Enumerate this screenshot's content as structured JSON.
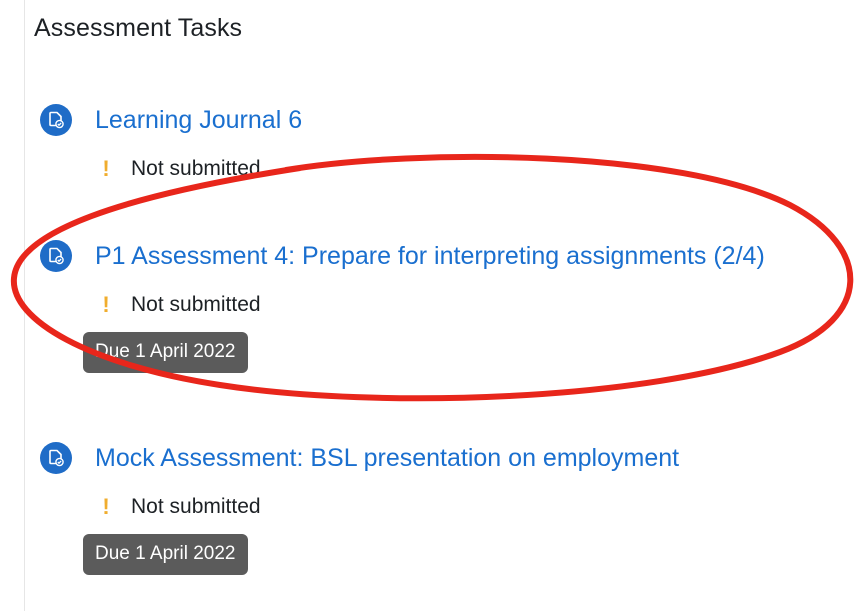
{
  "section": {
    "title": "Assessment Tasks"
  },
  "tasks": [
    {
      "title": "Learning Journal 6",
      "status": "Not submitted",
      "due": ""
    },
    {
      "title": "P1 Assessment 4: Prepare for interpreting assignments (2/4)",
      "status": "Not submitted",
      "due": "Due 1 April 2022"
    },
    {
      "title": "Mock Assessment: BSL presentation on employment",
      "status": "Not submitted",
      "due": "Due 1 April 2022"
    }
  ],
  "icons": {
    "task": "assignment-icon",
    "status": "exclamation-icon"
  },
  "colors": {
    "link": "#1a6fcf",
    "icon_bg": "#1f6cc7",
    "warning": "#f0ad2e",
    "badge_bg": "#5b5b5b",
    "annotation": "#e8261b"
  }
}
